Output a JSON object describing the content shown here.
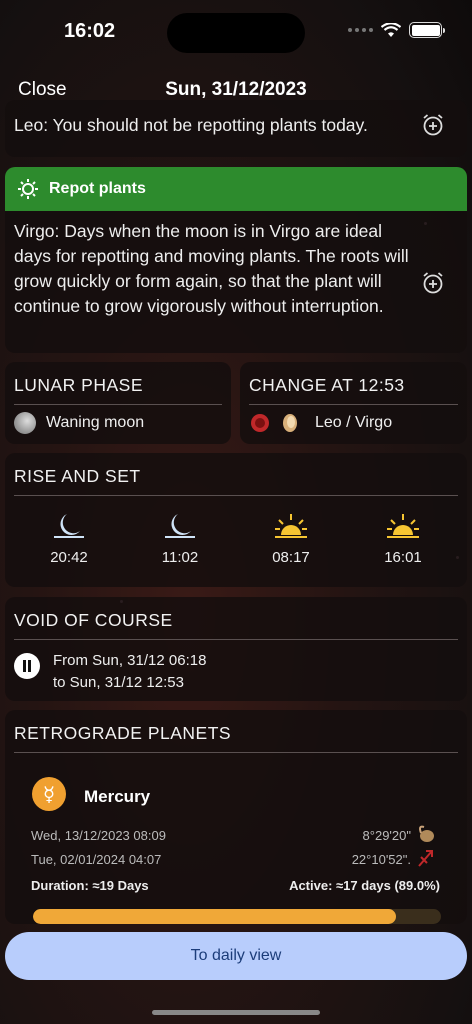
{
  "status": {
    "time": "16:02"
  },
  "nav": {
    "close": "Close",
    "title": "Sun, 31/12/2023"
  },
  "leo": {
    "text": "Leo: You should not be repotting plants today."
  },
  "virgo": {
    "header": "Repot plants",
    "text": "Virgo: Days when the moon is in Virgo are ideal days for repotting and moving plants. The roots will grow quickly or form again, so that the plant will continue to grow vigorously without interruption.",
    "accent": "#2d8b2d"
  },
  "lunar_phase": {
    "title": "LUNAR PHASE",
    "value": "Waning moon"
  },
  "change": {
    "title": "CHANGE AT 12:53",
    "value": "Leo / Virgo"
  },
  "rise_set": {
    "title": "RISE AND SET",
    "items": [
      {
        "icon": "moonrise-icon",
        "time": "20:42"
      },
      {
        "icon": "moonset-icon",
        "time": "11:02"
      },
      {
        "icon": "sunrise-icon",
        "time": "08:17"
      },
      {
        "icon": "sunset-icon",
        "time": "16:01"
      }
    ]
  },
  "void": {
    "title": "VOID OF COURSE",
    "from": "From Sun, 31/12 06:18",
    "to": "to Sun, 31/12 12:53"
  },
  "retro": {
    "title": "RETROGRADE PLANETS",
    "planet": "Mercury",
    "symbol": "☿",
    "start_date": "Wed, 13/12/2023 08:09",
    "end_date": "Tue, 02/01/2024 04:07",
    "start_pos": "8°29'20\"",
    "end_pos": "22°10'52\".",
    "duration": "Duration: ≈19 Days",
    "active": "Active: ≈17 days (89.0%)",
    "progress": 0.89,
    "accent": "#f0a838"
  },
  "footer": {
    "button": "To daily view"
  }
}
